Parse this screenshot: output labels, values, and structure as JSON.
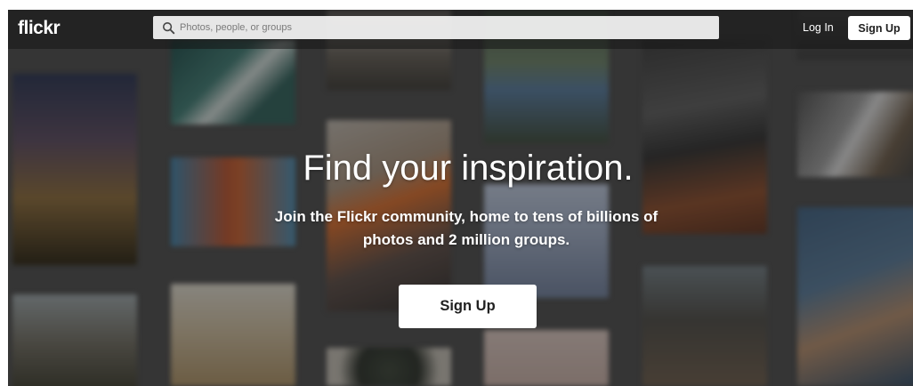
{
  "header": {
    "logo_text": "flickr",
    "search_placeholder": "Photos, people, or groups",
    "login_label": "Log In",
    "signup_label": "Sign Up"
  },
  "hero": {
    "title": "Find your inspiration.",
    "subtitle": "Join the Flickr community, home to tens of billions of photos and 2 million groups.",
    "cta_label": "Sign Up"
  },
  "icons": {
    "search": "search-icon"
  },
  "colors": {
    "topbar_bg": "#2b2b2b",
    "button_bg": "#ffffff",
    "button_text": "#212121",
    "text_light": "#ffffff"
  }
}
